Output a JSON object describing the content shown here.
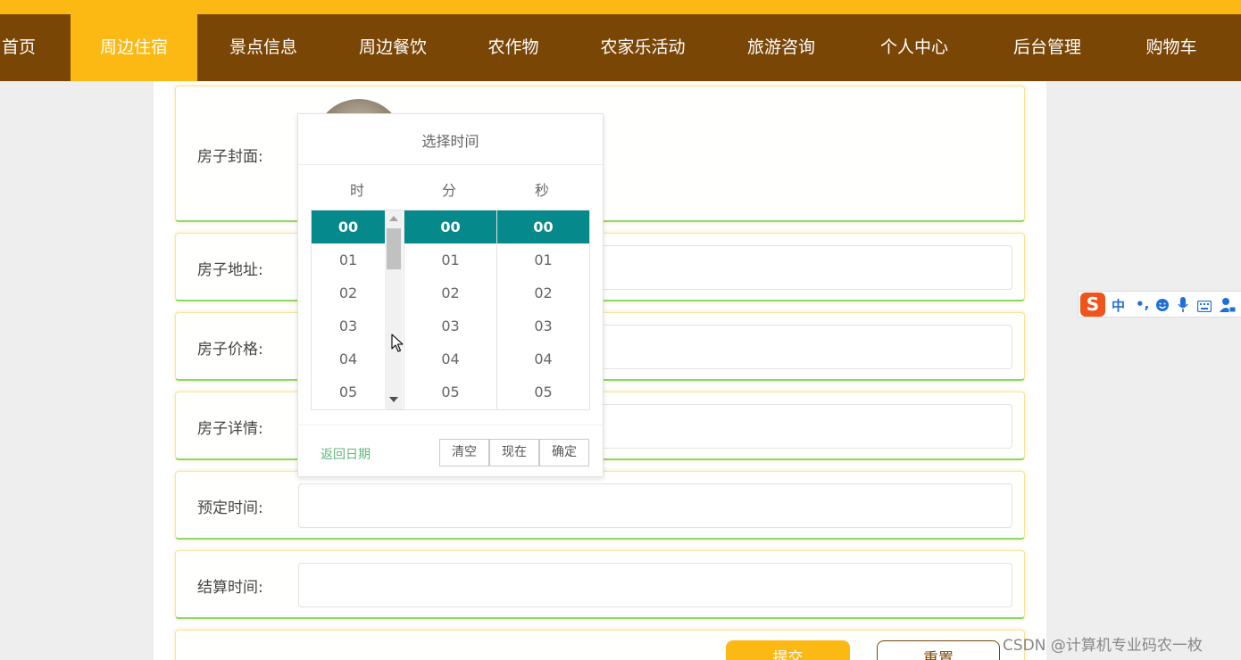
{
  "nav": {
    "items": [
      "首页",
      "周边住宿",
      "景点信息",
      "周边餐饮",
      "农作物",
      "农家乐活动",
      "旅游咨询",
      "个人中心",
      "后台管理",
      "购物车"
    ],
    "active_index": 1
  },
  "form": {
    "cover_label": "房子封面:",
    "address_label": "房子地址:",
    "price_label": "房子价格:",
    "detail_label": "房子详情:",
    "booking_time_label": "预定时间:",
    "settle_time_label": "结算时间:",
    "submit_label": "提交",
    "reset_label": "重置"
  },
  "time_picker": {
    "title": "选择时间",
    "headers": {
      "hour": "时",
      "minute": "分",
      "second": "秒"
    },
    "hours": [
      "00",
      "01",
      "02",
      "03",
      "04",
      "05"
    ],
    "minutes": [
      "00",
      "01",
      "02",
      "03",
      "04",
      "05"
    ],
    "seconds": [
      "00",
      "01",
      "02",
      "03",
      "04",
      "05"
    ],
    "selected": {
      "hour": "00",
      "minute": "00",
      "second": "00"
    },
    "back_label": "返回日期",
    "clear_label": "清空",
    "now_label": "现在",
    "confirm_label": "确定"
  },
  "ime_bar": {
    "logo": "S",
    "mode": "中",
    "punct": "•,"
  },
  "colors": {
    "top_strip": "#fdb913",
    "nav_bg": "#7a4606",
    "nav_active": "#fdb913",
    "picker_selected": "#05898a",
    "back_link": "#5fb878"
  },
  "watermark": "CSDN @计算机专业码农一枚"
}
